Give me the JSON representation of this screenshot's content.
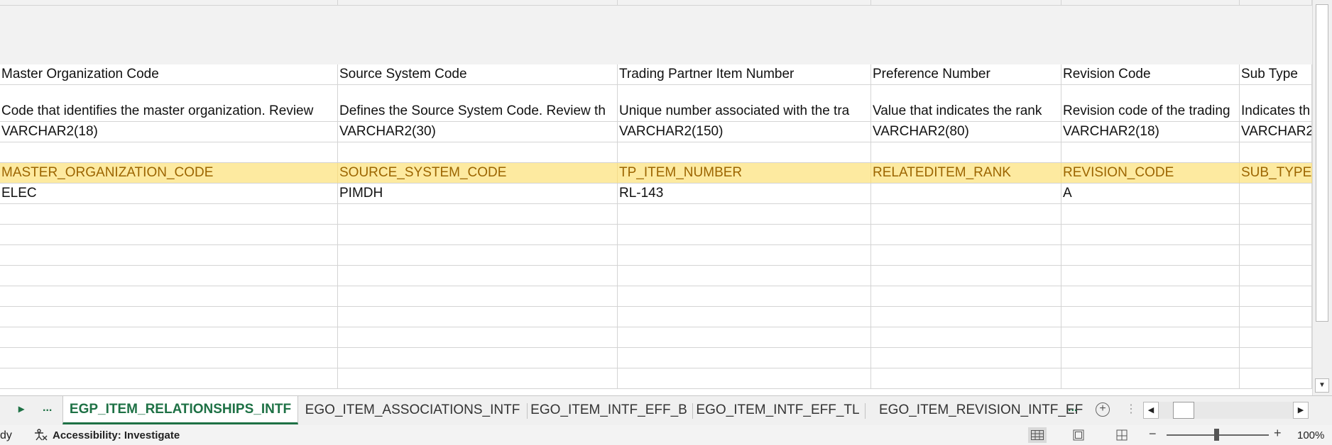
{
  "sheet": {
    "header_labels": [
      "Master Organization Code",
      "Source System Code",
      "Trading Partner Item Number",
      "Preference Number",
      "Revision Code",
      "Sub Type"
    ],
    "descriptions": [
      "Code that identifies the master organization. Review",
      "Defines the Source System Code. Review th",
      "Unique number associated with the tra",
      "Value that indicates the rank",
      "Revision code of the trading",
      "Indicates th"
    ],
    "data_types": [
      "VARCHAR2(18)",
      "VARCHAR2(30)",
      "VARCHAR2(150)",
      "VARCHAR2(80)",
      "VARCHAR2(18)",
      "VARCHAR2"
    ],
    "column_names": [
      "MASTER_ORGANIZATION_CODE",
      "SOURCE_SYSTEM_CODE",
      "TP_ITEM_NUMBER",
      "RELATEDITEM_RANK",
      "REVISION_CODE",
      "SUB_TYPE"
    ],
    "data_row": [
      "ELEC",
      "PIMDH",
      "RL-143",
      "",
      "A",
      ""
    ]
  },
  "tabs": {
    "more_label": "...",
    "items": [
      "EGP_ITEM_RELATIONSHIPS_INTF",
      "EGO_ITEM_ASSOCIATIONS_INTF",
      "EGO_ITEM_INTF_EFF_B",
      "EGO_ITEM_INTF_EFF_TL",
      "EGO_ITEM_REVISION_INTF_EF"
    ],
    "overflow_label": "...",
    "active_index": 0
  },
  "status": {
    "mode": "dy",
    "accessibility": "Accessibility: Investigate",
    "zoom_level": "100%"
  },
  "colors": {
    "accent_green": "#1e7145",
    "highlight_fill": "#fdeaa0",
    "highlight_text": "#9c6500"
  }
}
